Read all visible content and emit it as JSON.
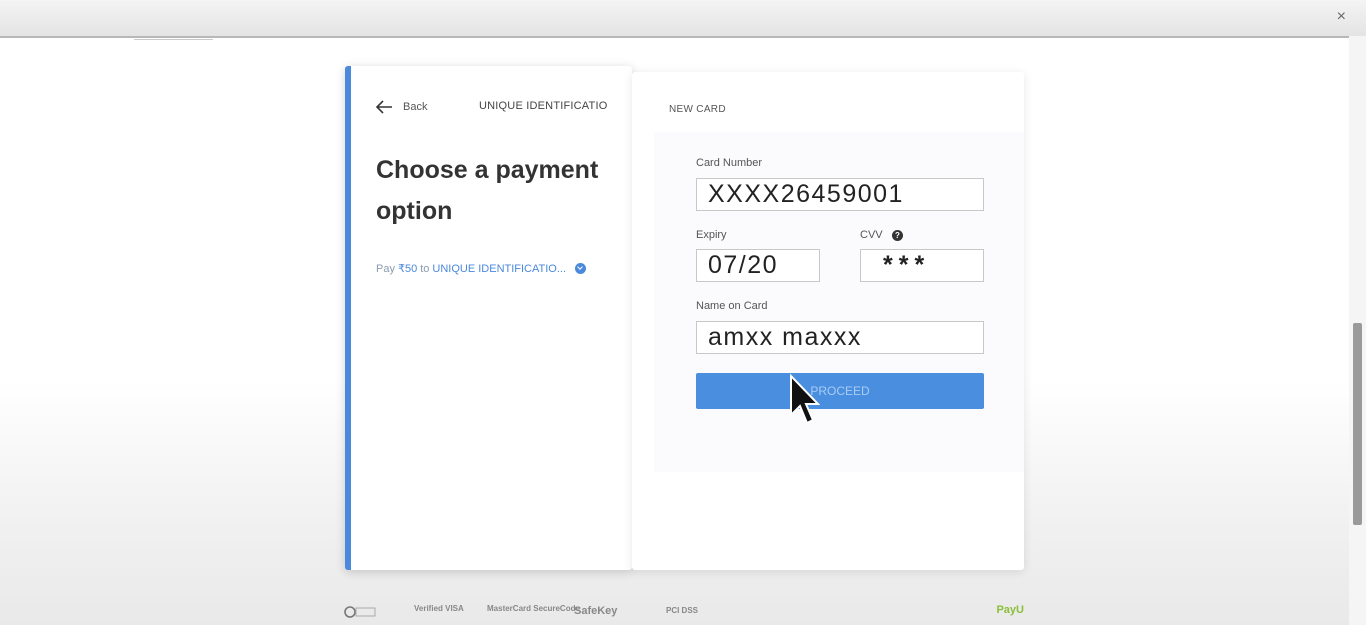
{
  "window": {
    "close_glyph": "×"
  },
  "payment_info": {
    "back_label": "Back",
    "merchant_name": "UNIQUE IDENTIFICATIO",
    "title": "Choose a payment option",
    "pay_prefix": "Pay",
    "pay_amount": "₹50",
    "pay_to": "to",
    "pay_merchant": "UNIQUE IDENTIFICATIO..."
  },
  "card_form": {
    "section_label": "NEW CARD",
    "card_number_label": "Card Number",
    "card_number_value": "XXXX26459001",
    "expiry_label": "Expiry",
    "expiry_value": "07/20",
    "cvv_label": "CVV",
    "cvv_value": "***",
    "name_label": "Name on Card",
    "name_value": "amxx maxxx",
    "proceed_label": "PROCEED"
  },
  "footer": {
    "badges": [
      "Verified VISA",
      "MasterCard SecureCode",
      "SafeKey",
      "PCI DSS"
    ],
    "brand": "PayU"
  },
  "icons": [
    "back-arrow-icon",
    "chevron-down-icon",
    "help-icon",
    "close-icon",
    "mouse-cursor-icon"
  ],
  "colors": {
    "accent": "#4a89dc",
    "proceed": "#4a8ee0",
    "payu": "#8bbf3a"
  }
}
